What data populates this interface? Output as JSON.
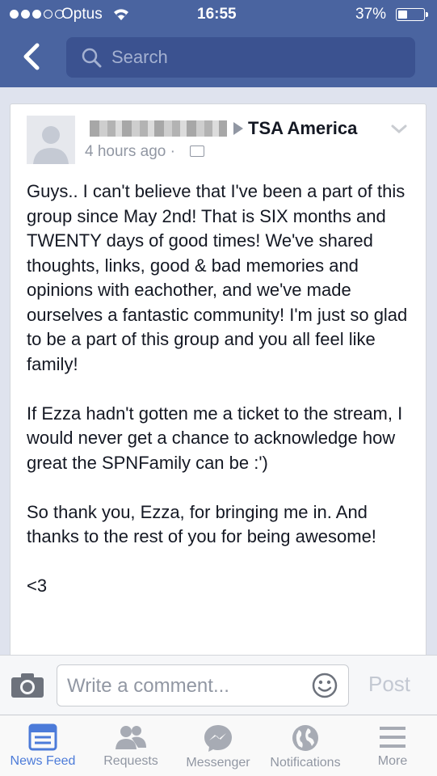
{
  "status_bar": {
    "carrier": "Optus",
    "time": "16:55",
    "battery": "37%",
    "battery_level": 0.37
  },
  "nav": {
    "search_placeholder": "Search"
  },
  "post": {
    "group_name": "TSA America",
    "timestamp": "4 hours ago",
    "separator": "·",
    "paragraphs": [
      "Guys.. I can't believe that I've been a part of this group since May 2nd! That is SIX months and TWENTY days of good times! We've shared thoughts, links, good & bad memories and opinions with eachother, and we've made ourselves a fantastic community! I'm just so glad to be a part of this group and you all feel like family!",
      "If Ezza hadn't gotten me a ticket to the stream, I would never get a chance to acknowledge how great the SPNFamily can be :')",
      "So thank you, Ezza, for bringing me in. And thanks to the rest of you for being awesome!",
      "<3"
    ]
  },
  "comment_bar": {
    "placeholder": "Write a comment...",
    "post_label": "Post"
  },
  "tabs": [
    {
      "label": "News Feed",
      "icon": "news-feed-icon",
      "active": true
    },
    {
      "label": "Requests",
      "icon": "requests-icon",
      "active": false
    },
    {
      "label": "Messenger",
      "icon": "messenger-icon",
      "active": false
    },
    {
      "label": "Notifications",
      "icon": "globe-icon",
      "active": false
    },
    {
      "label": "More",
      "icon": "menu-icon",
      "active": false
    }
  ],
  "colors": {
    "brand_blue": "#4a64a0",
    "active_tab": "#4c7bd9",
    "muted": "#9197a3"
  }
}
